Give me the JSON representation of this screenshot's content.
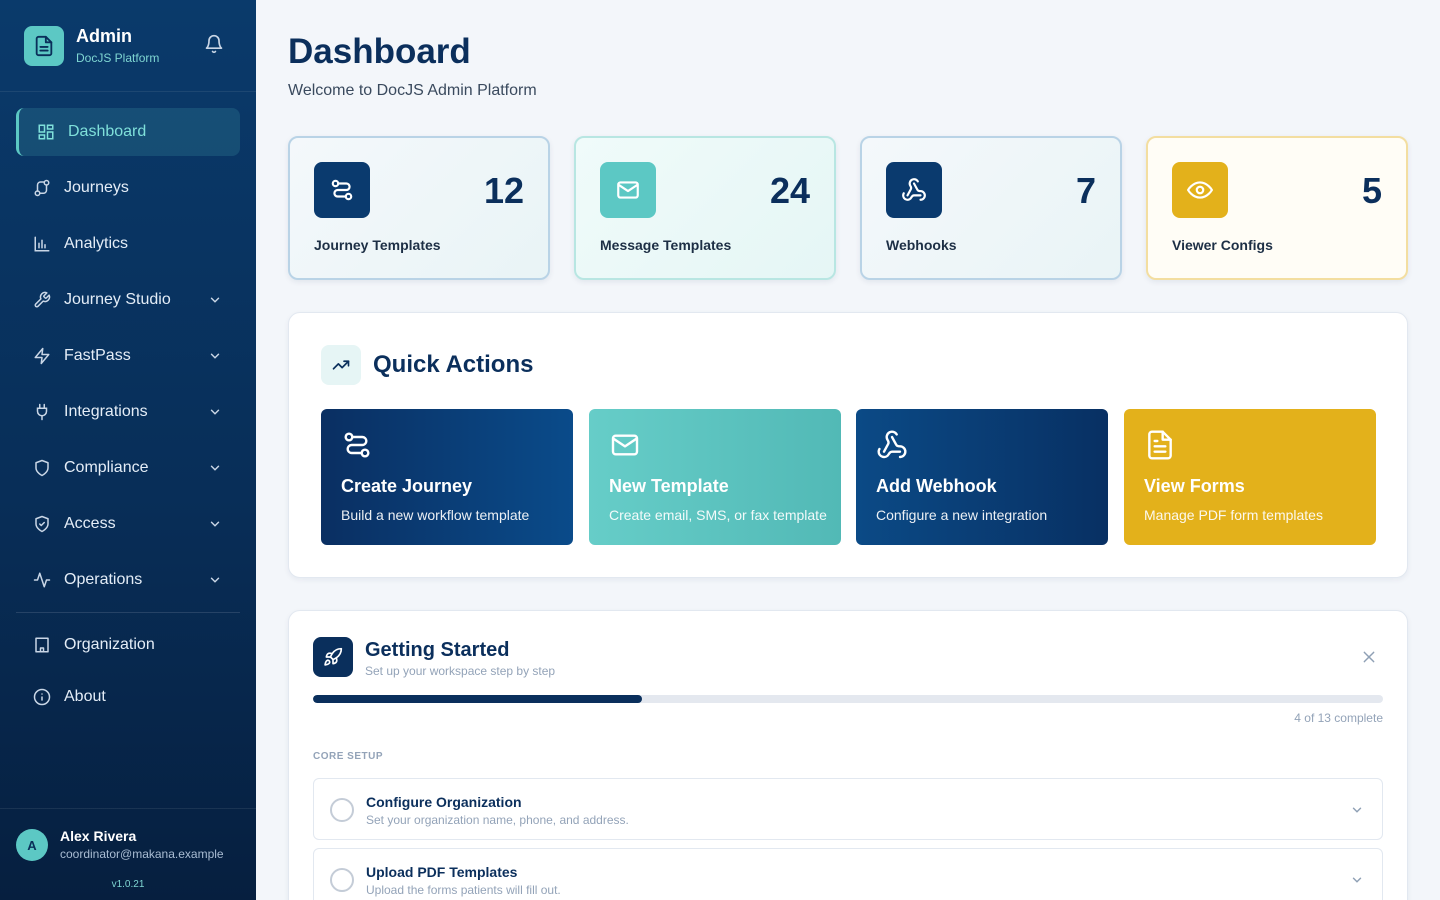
{
  "sidebar": {
    "brand_title": "Admin",
    "brand_subtitle": "DocJS Platform",
    "items": [
      {
        "label": "Dashboard",
        "icon": "grid-icon",
        "active": true
      },
      {
        "label": "Journeys",
        "icon": "route-icon"
      },
      {
        "label": "Analytics",
        "icon": "bar-chart-icon"
      },
      {
        "label": "Journey Studio",
        "icon": "wrench-icon",
        "expandable": true
      },
      {
        "label": "FastPass",
        "icon": "lightning-icon",
        "expandable": true
      },
      {
        "label": "Integrations",
        "icon": "plug-icon",
        "expandable": true
      },
      {
        "label": "Compliance",
        "icon": "shield-icon",
        "expandable": true
      },
      {
        "label": "Access",
        "icon": "shield-check-icon",
        "expandable": true
      },
      {
        "label": "Operations",
        "icon": "activity-icon",
        "expandable": true
      }
    ],
    "secondary_items": [
      {
        "label": "Organization",
        "icon": "building-icon"
      },
      {
        "label": "About",
        "icon": "info-icon"
      }
    ],
    "user": {
      "initial": "A",
      "name": "Alex Rivera",
      "email": "coordinator@makana.example"
    },
    "version": "v1.0.21"
  },
  "header": {
    "title": "Dashboard",
    "subtitle": "Welcome to DocJS Admin Platform"
  },
  "stats": [
    {
      "label": "Journey Templates",
      "value": "12",
      "icon": "route-icon",
      "color": "#0a3a6e"
    },
    {
      "label": "Message Templates",
      "value": "24",
      "icon": "mail-icon",
      "color": "#5cc8c4"
    },
    {
      "label": "Webhooks",
      "value": "7",
      "icon": "webhook-icon",
      "color": "#0a3a6e"
    },
    {
      "label": "Viewer Configs",
      "value": "5",
      "icon": "eye-icon",
      "color": "#e3b11b"
    }
  ],
  "quick_actions": {
    "title": "Quick Actions",
    "cards": [
      {
        "title": "Create Journey",
        "desc": "Build a new workflow template",
        "icon": "route-icon"
      },
      {
        "title": "New Template",
        "desc": "Create email, SMS, or fax template",
        "icon": "mail-icon"
      },
      {
        "title": "Add Webhook",
        "desc": "Configure a new integration",
        "icon": "webhook-icon"
      },
      {
        "title": "View Forms",
        "desc": "Manage PDF form templates",
        "icon": "file-icon"
      }
    ]
  },
  "getting_started": {
    "title": "Getting Started",
    "subtitle": "Set up your workspace step by step",
    "progress_completed": 4,
    "progress_total": 13,
    "progress_text": "4 of 13 complete",
    "section_label": "CORE SETUP",
    "steps": [
      {
        "title": "Configure Organization",
        "desc": "Set your organization name, phone, and address."
      },
      {
        "title": "Upload PDF Templates",
        "desc": "Upload the forms patients will fill out."
      }
    ]
  }
}
